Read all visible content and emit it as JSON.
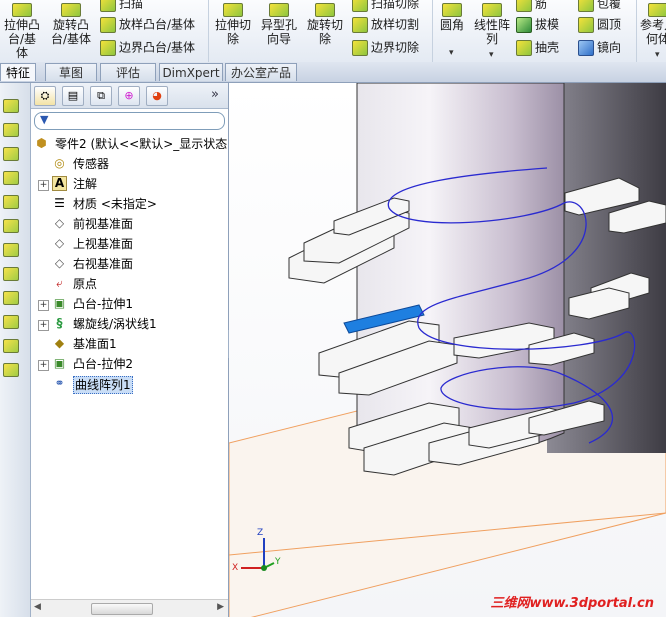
{
  "ribbon": {
    "extrude_boss": "拉伸凸台/基体",
    "revolve_boss": "旋转凸台/基体",
    "sweep": "扫描",
    "loft_boss": "放样凸台/基体",
    "boundary_boss": "边界凸台/基体",
    "extrude_cut": "拉伸切除",
    "hole_wizard": "异型孔向导",
    "revolve_cut": "旋转切除",
    "sweep_cut": "扫描切除",
    "loft_cut": "放样切割",
    "boundary_cut": "边界切除",
    "fillet": "圆角",
    "linear_pattern": "线性阵列",
    "rib": "筋",
    "draft": "拔模",
    "shell": "抽壳",
    "wrap": "包覆",
    "dome": "圆顶",
    "mirror": "镜向",
    "ref_geometry": "参考几何体"
  },
  "tabs": [
    "特征",
    "草图",
    "评估",
    "DimXpert",
    "办公室产品"
  ],
  "panel": {
    "tabs": [
      "feature-manager",
      "property-manager",
      "configuration-manager",
      "dimxpert-manager",
      "display-manager"
    ],
    "more": "»",
    "filter_icon": "filter-icon",
    "tree": [
      {
        "label": "零件2  (默认<<默认>_显示状态",
        "icon": "part-icon",
        "expand": ""
      },
      {
        "label": "传感器",
        "icon": "sensor-icon",
        "expand": ""
      },
      {
        "label": "注解",
        "icon": "annotation-icon",
        "expand": "+"
      },
      {
        "label": "材质 <未指定>",
        "icon": "material-icon",
        "expand": ""
      },
      {
        "label": "前视基准面",
        "icon": "plane-icon",
        "expand": ""
      },
      {
        "label": "上视基准面",
        "icon": "plane-icon",
        "expand": ""
      },
      {
        "label": "右视基准面",
        "icon": "plane-icon",
        "expand": ""
      },
      {
        "label": "原点",
        "icon": "origin-icon",
        "expand": ""
      },
      {
        "label": "凸台-拉伸1",
        "icon": "extrude-icon",
        "expand": "+"
      },
      {
        "label": "螺旋线/涡状线1",
        "icon": "helix-icon",
        "expand": "+"
      },
      {
        "label": "基准面1",
        "icon": "plane-icon",
        "expand": ""
      },
      {
        "label": "凸台-拉伸2",
        "icon": "extrude-icon",
        "expand": "+"
      },
      {
        "label": "曲线阵列1",
        "icon": "curve-pattern-icon",
        "expand": "",
        "selected": true
      }
    ]
  },
  "viewport": {
    "axes": {
      "x": "X",
      "y": "Y",
      "z": "Z"
    },
    "watermark": "三维网www.3dportal.cn"
  },
  "colors": {
    "helix": "#2a2ad0",
    "selected_face": "#1e7fe0",
    "plane_edge": "#f0a060"
  }
}
